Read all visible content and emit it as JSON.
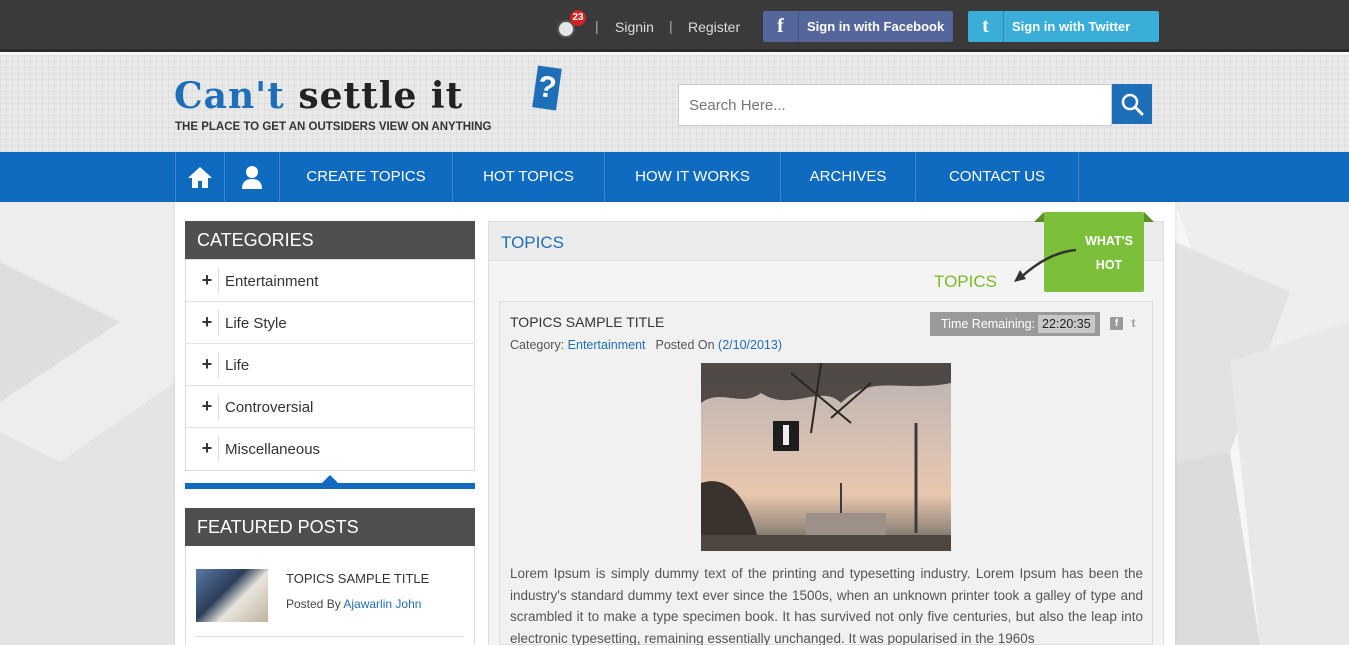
{
  "topbar": {
    "notification_count": "23",
    "sep1": "|",
    "signin": "Signin",
    "sep2": "|",
    "register": "Register",
    "facebook_icon": "f",
    "facebook_label": "Sign in with Facebook",
    "twitter_icon": "t",
    "twitter_label": "Sign in with Twitter"
  },
  "header": {
    "logo_part1": "Can't",
    "logo_part2": " settle it",
    "logo_mark": "?",
    "tagline": "THE PLACE TO GET AN OUTSIDERS VIEW ON ANYTHING",
    "search_placeholder": "Search Here..."
  },
  "nav": {
    "items": [
      {
        "label": "CREATE TOPICS"
      },
      {
        "label": "HOT TOPICS"
      },
      {
        "label": "HOW IT WORKS"
      },
      {
        "label": "ARCHIVES"
      },
      {
        "label": "CONTACT US"
      }
    ]
  },
  "sidebar": {
    "categories_title": "CATEGORIES",
    "plus": "+",
    "categories": [
      "Entertainment",
      "Life Style",
      "Life",
      "Controversial",
      "Miscellaneous"
    ],
    "featured_title": "FEATURED POSTS",
    "featured": {
      "title": "TOPICS SAMPLE TITLE",
      "posted_by_label": "Posted By ",
      "author": "Ajawarlin John"
    }
  },
  "content": {
    "header_title": "TOPICS",
    "section_title": "TOPICS",
    "whats_hot_line1": "WHAT'S",
    "whats_hot_line2": "HOT",
    "card": {
      "title": "TOPICS SAMPLE TITLE",
      "category_label": "Category: ",
      "category": "Entertainment",
      "posted_on_label": "Posted On ",
      "posted_on": "(2/10/2013)",
      "time_remaining_label": "Time Remaining:",
      "time_remaining": "22:20:35",
      "share_fb": "f",
      "share_tw": "t",
      "body": "Lorem Ipsum is simply dummy text of the printing and typesetting industry. Lorem Ipsum has been the industry's standard dummy text ever since the 1500s, when an unknown printer took a galley of type and scrambled it to make a type specimen book. It has survived not only five centuries, but also the leap into electronic typesetting, remaining essentially unchanged. It was popularised in the 1960s"
    }
  },
  "colors": {
    "brand_blue": "#0f6bc0",
    "accent_green": "#7bbf3a",
    "facebook": "#55679a",
    "twitter": "#3aaed8"
  }
}
